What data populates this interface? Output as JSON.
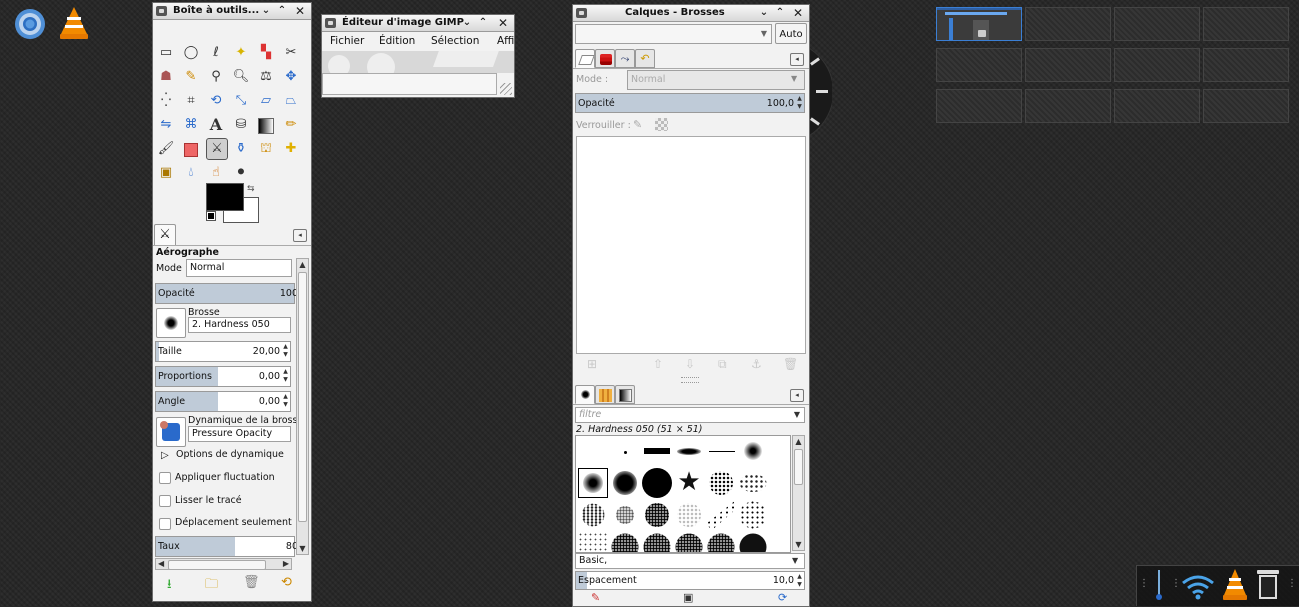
{
  "colors": {
    "desktop": "#252525",
    "accent_blue": "#3b7fd4",
    "scale_fill": "#bfcbd8",
    "fg_color": "#000000",
    "bg_color": "#ffffff"
  },
  "toolbox": {
    "title": "Boîte à outils...",
    "tool_options": {
      "heading": "Aérographe",
      "mode_label": "Mode :",
      "mode_value": "Normal",
      "opacity_label": "Opacité",
      "opacity_value": "100",
      "brush_label": "Brosse",
      "brush_value": "2. Hardness 050",
      "size_label": "Taille",
      "size_value": "20,00",
      "proportions_label": "Proportions",
      "proportions_value": "0,00",
      "angle_label": "Angle",
      "angle_value": "0,00",
      "dynamics_label": "Dynamique de la brosse",
      "dynamics_value": "Pressure Opacity",
      "dynamics_options_label": "Options de dynamique",
      "apply_jitter_label": "Appliquer fluctuation",
      "smooth_stroke_label": "Lisser le tracé",
      "incremental_label": "Déplacement seulement",
      "rate_label": "Taux",
      "rate_value": "80"
    }
  },
  "image_window": {
    "title": "Éditeur d'image GIMP",
    "menu": [
      "Fichier",
      "Édition",
      "Sélection",
      "Affi"
    ]
  },
  "layers_dock": {
    "title": "Calques - Brosses",
    "auto_button": "Auto",
    "mode_label": "Mode :",
    "mode_value": "Normal",
    "opacity_label": "Opacité",
    "opacity_value": "100,0",
    "lock_label": "Verrouiller :",
    "brushes": {
      "filter_placeholder": "filtre",
      "selected_brush": "2. Hardness 050 (51 × 51)",
      "tag_value": "Basic,",
      "spacing_label": "Espacement",
      "spacing_value": "10,0"
    }
  },
  "launcher_icons": [
    "chromium-icon",
    "vlc-icon"
  ],
  "tray_icons": [
    "thermometer-icon",
    "wifi-icon",
    "vlc-icon",
    "trash-icon"
  ]
}
